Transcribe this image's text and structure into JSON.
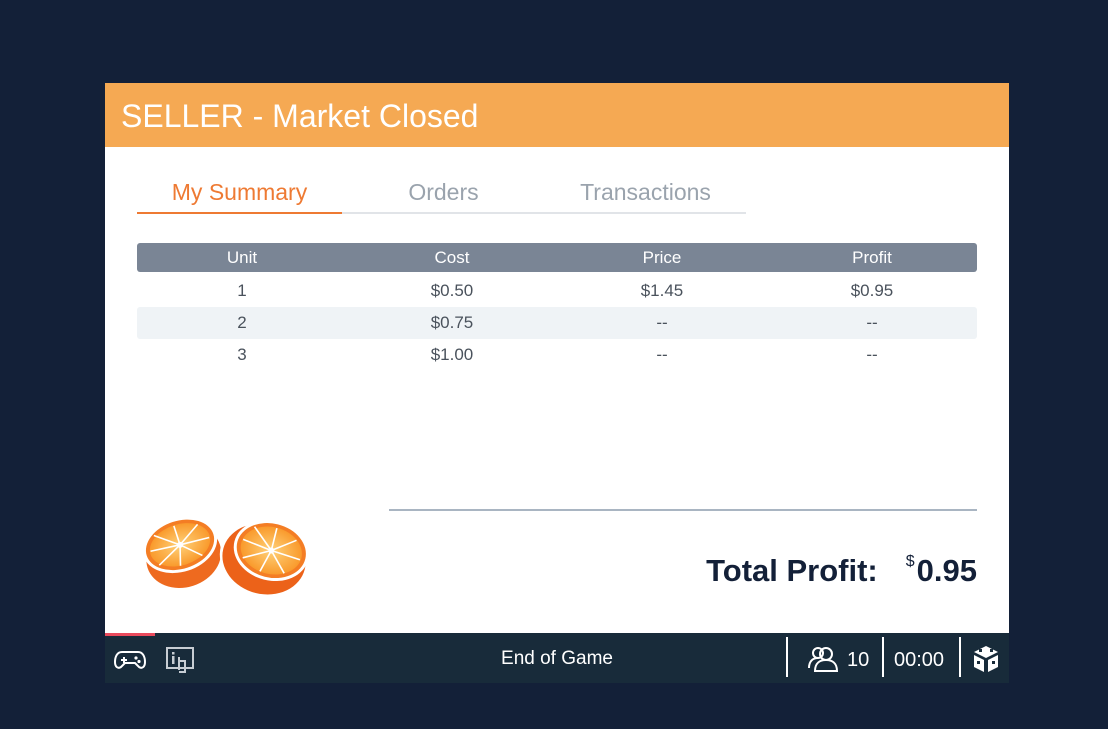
{
  "header": {
    "title": "SELLER - Market Closed"
  },
  "tabs": [
    {
      "label": "My Summary",
      "active": true
    },
    {
      "label": "Orders",
      "active": false
    },
    {
      "label": "Transactions",
      "active": false
    }
  ],
  "table": {
    "columns": [
      "Unit",
      "Cost",
      "Price",
      "Profit"
    ],
    "rows": [
      [
        "1",
        "$0.50",
        "$1.45",
        "$0.95"
      ],
      [
        "2",
        "$0.75",
        "--",
        "--"
      ],
      [
        "3",
        "$1.00",
        "--",
        "--"
      ]
    ]
  },
  "summary": {
    "label": "Total Profit:",
    "currency": "$",
    "value": "0.95"
  },
  "footer": {
    "status": "End of Game",
    "players": "10",
    "timer": "00:00",
    "icons": [
      "gamepad-icon",
      "info-touch-icon",
      "users-icon",
      "logo-cube-icon"
    ]
  },
  "colors": {
    "header": "#f5a953",
    "accent": "#ee7a33",
    "background": "#132038",
    "footer": "#182b3a",
    "table_header": "#7a8595"
  }
}
